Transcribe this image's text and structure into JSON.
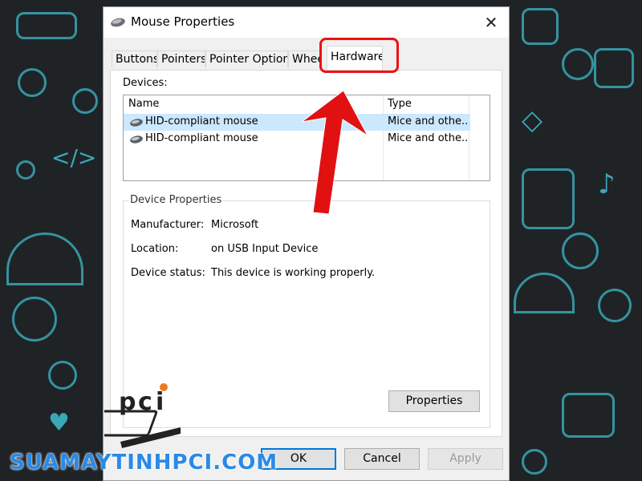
{
  "window": {
    "title": "Mouse Properties",
    "close_icon": "close-icon"
  },
  "tabs": [
    {
      "label": "Buttons"
    },
    {
      "label": "Pointers"
    },
    {
      "label": "Pointer Options"
    },
    {
      "label": "Wheel"
    },
    {
      "label": "Hardware",
      "active": true
    }
  ],
  "devices": {
    "label": "Devices:",
    "columns": {
      "name": "Name",
      "type": "Type"
    },
    "rows": [
      {
        "name": "HID-compliant mouse",
        "type": "Mice and othe...",
        "selected": true
      },
      {
        "name": "HID-compliant mouse",
        "type": "Mice and othe...",
        "selected": false
      }
    ]
  },
  "device_properties": {
    "title": "Device Properties",
    "manufacturer_label": "Manufacturer:",
    "manufacturer_value": "Microsoft",
    "location_label": "Location:",
    "location_value": "on USB Input Device",
    "status_label": "Device status:",
    "status_value": "This device is working properly.",
    "properties_button": "Properties"
  },
  "buttons": {
    "ok": "OK",
    "cancel": "Cancel",
    "apply": "Apply"
  },
  "annotation": {
    "color": "#e11111"
  },
  "watermark": {
    "site": "SUAMAYTINHPCI.COM"
  },
  "colors": {
    "background": "#1f2326",
    "doodle": "#3aa7b5",
    "selection": "#cce8ff",
    "default_button_border": "#0078d7"
  }
}
